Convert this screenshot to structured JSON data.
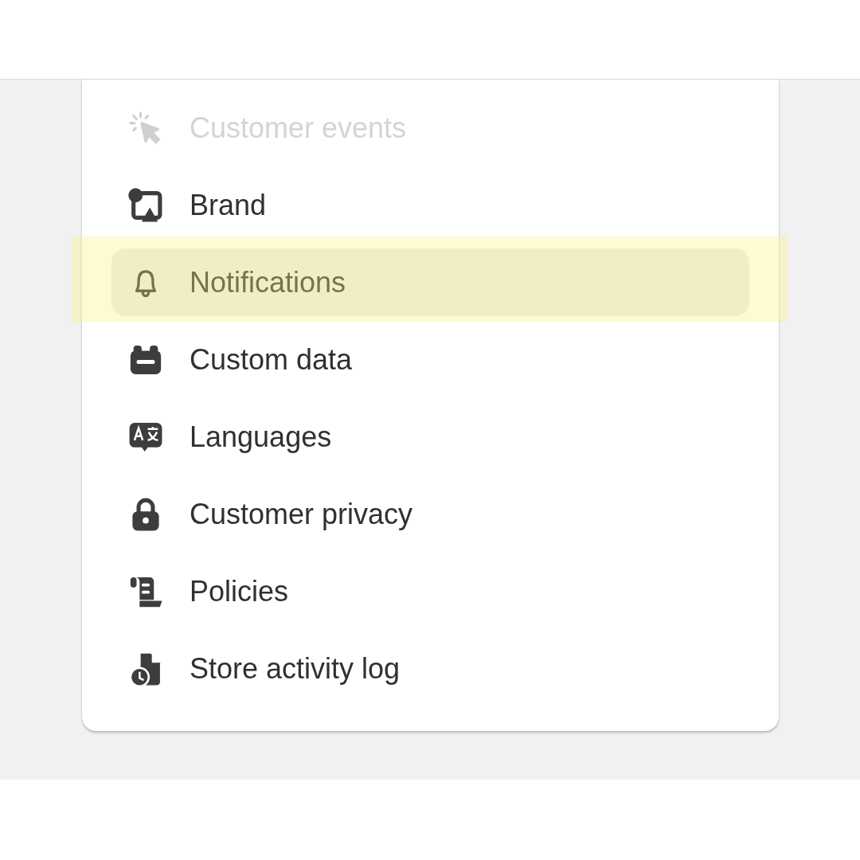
{
  "menu": {
    "items": [
      {
        "label": "Customer events",
        "disabled": true,
        "selected": false
      },
      {
        "label": "Brand",
        "disabled": false,
        "selected": false
      },
      {
        "label": "Notifications",
        "disabled": false,
        "selected": true
      },
      {
        "label": "Custom data",
        "disabled": false,
        "selected": false
      },
      {
        "label": "Languages",
        "disabled": false,
        "selected": false
      },
      {
        "label": "Customer privacy",
        "disabled": false,
        "selected": false
      },
      {
        "label": "Policies",
        "disabled": false,
        "selected": false
      },
      {
        "label": "Store activity log",
        "disabled": false,
        "selected": false
      }
    ]
  }
}
